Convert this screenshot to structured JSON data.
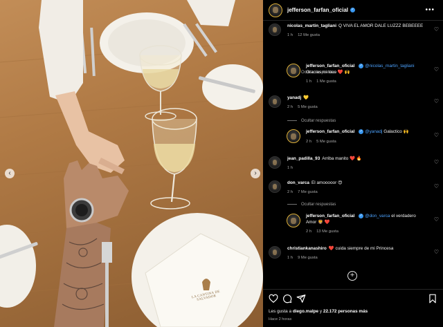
{
  "photo": {
    "nav_prev": "‹",
    "nav_next": "›",
    "napkin_text": "LA CANTINA DE SALVADOR"
  },
  "header": {
    "username": "jefferson_farfan_oficial",
    "verified_mark": "✓",
    "more_icon": "•••"
  },
  "comments": [
    {
      "user": "nicolas_martin_tagliani",
      "text": "Q VIVA EL AMOR DALE LUZZZ BEBEEEE",
      "time": "1 h",
      "likes": "12 Me gusta"
    },
    {
      "user": "jefferson_farfan_oficial",
      "mention": "@nicolas_martin_tagliani",
      "text": "Gracias mi loco ❤️ 🙌",
      "time": "1 h",
      "likes": "1 Me gusta",
      "is_reply": true
    },
    {
      "user": "yanadj",
      "text": "💛",
      "time": "2 h",
      "likes": "5 Me gusta"
    },
    {
      "user": "jefferson_farfan_oficial",
      "mention": "@yanadj",
      "text": "Galactico 🙌",
      "time": "2 h",
      "likes": "5 Me gusta",
      "is_reply": true
    },
    {
      "user": "jean_padilla_93",
      "text": "Arriba manito ❤️ 🔥",
      "time": "1 h",
      "likes": ""
    },
    {
      "user": "don_varca",
      "text": "El amooooor 😍",
      "time": "2 h",
      "likes": "7 Me gusta"
    },
    {
      "user": "jefferson_farfan_oficial",
      "mention": "@don_varca",
      "text": "el verdadero Amor 🦁 ❤️",
      "time": "2 h",
      "likes": "13 Me gusta",
      "is_reply": true
    },
    {
      "user": "christiankanashiro",
      "text": "❤️ cuida siempre de mi Princesa",
      "time": "1 h",
      "likes": "9 Me gusta"
    }
  ],
  "hide_replies_label": "Ocultar respuestas",
  "more_comments_icon": "+",
  "actions": {
    "liked_by_prefix": "Les gusta a",
    "liked_by_user": "diego.malpe",
    "liked_by_suffix": "y",
    "liked_by_count": "22.172 personas más",
    "posted_time": "Hace 2 horas"
  },
  "colors": {
    "background": "#000000",
    "link": "#4da3ff",
    "muted": "#a8a8a8",
    "verified": "#3897f0"
  },
  "icons": [
    "heart-icon",
    "comment-icon",
    "share-icon",
    "bookmark-icon",
    "more-icon",
    "add-circle-icon"
  ]
}
